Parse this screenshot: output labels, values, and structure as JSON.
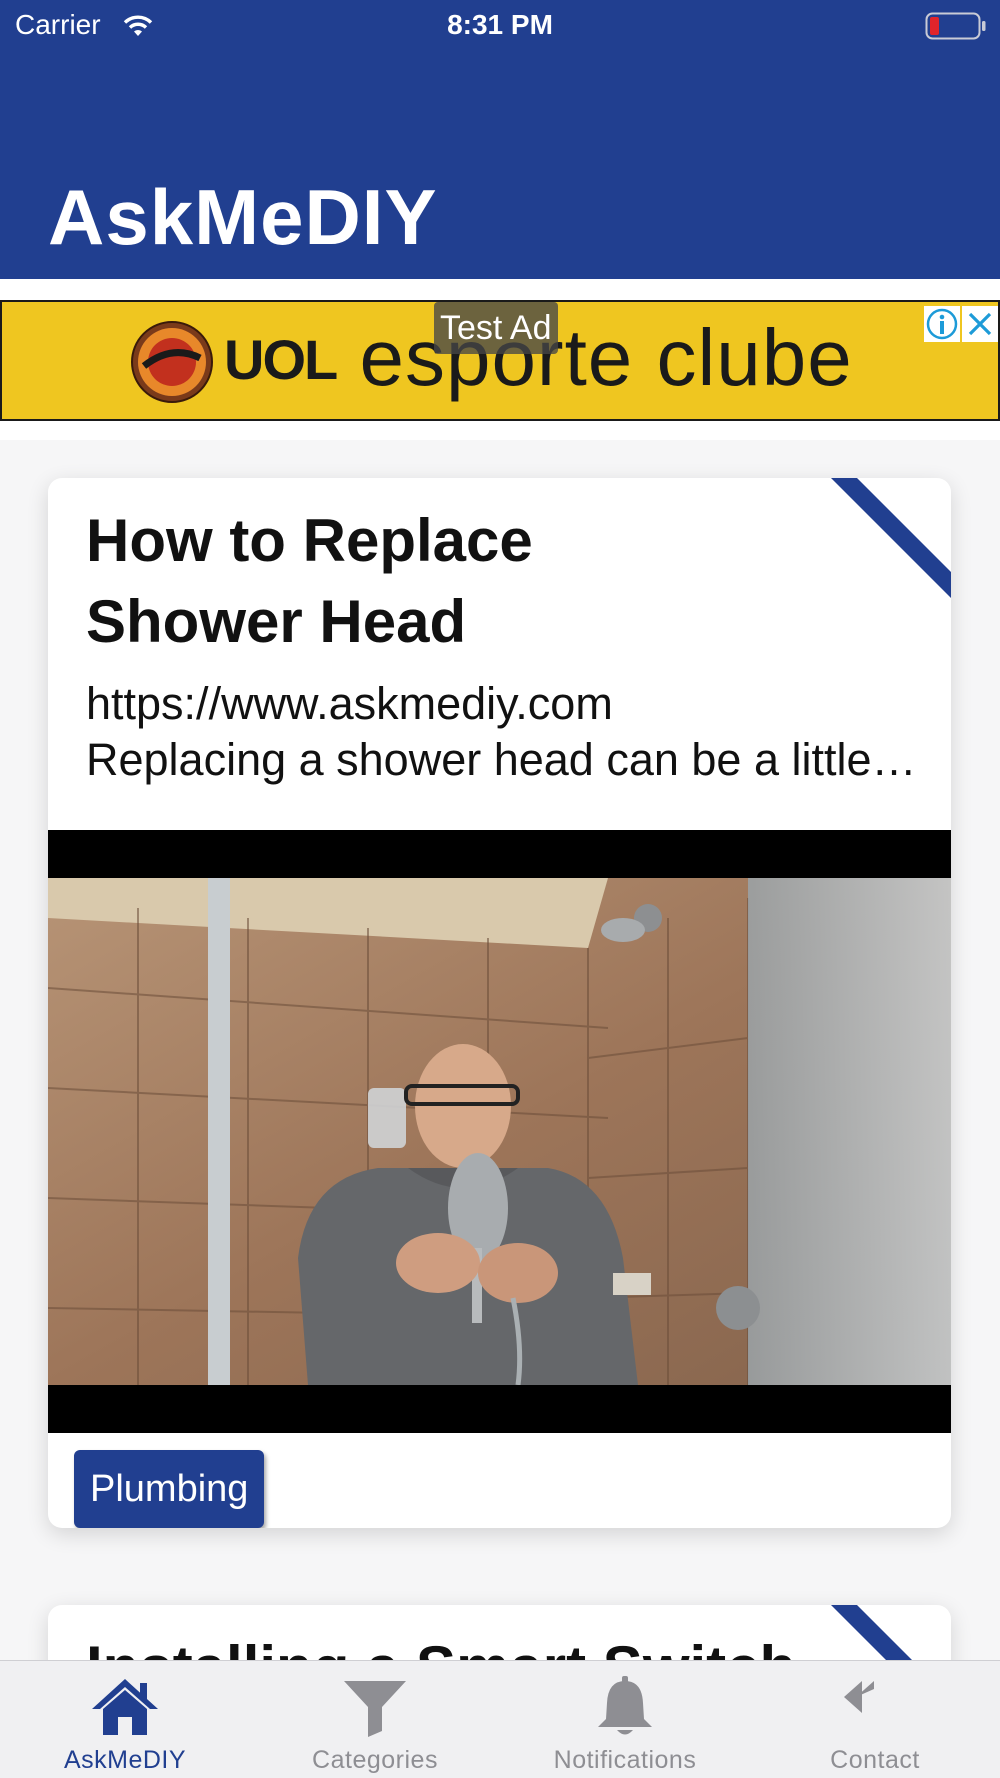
{
  "status_bar": {
    "carrier": "Carrier",
    "time": "8:31 PM"
  },
  "header": {
    "title": "AskMeDIY"
  },
  "ad": {
    "badge": "Test Ad",
    "brand": "UOL",
    "text": "esporte clube"
  },
  "posts": [
    {
      "title": "How to Replace Shower Head",
      "url": "https://www.askmediy.com",
      "excerpt": "Replacing a shower head can be a little…",
      "category": "Plumbing"
    },
    {
      "title": "Installing a Smart Switch"
    }
  ],
  "tabs": [
    {
      "label": "AskMeDIY",
      "icon": "home-icon",
      "active": true
    },
    {
      "label": "Categories",
      "icon": "filter-icon",
      "active": false
    },
    {
      "label": "Notifications",
      "icon": "bell-icon",
      "active": false
    },
    {
      "label": "Contact",
      "icon": "reply-all-icon",
      "active": false
    }
  ],
  "colors": {
    "brand": "#213f90",
    "ad_background": "#efc620",
    "inactive_tab": "#8e8e93"
  }
}
